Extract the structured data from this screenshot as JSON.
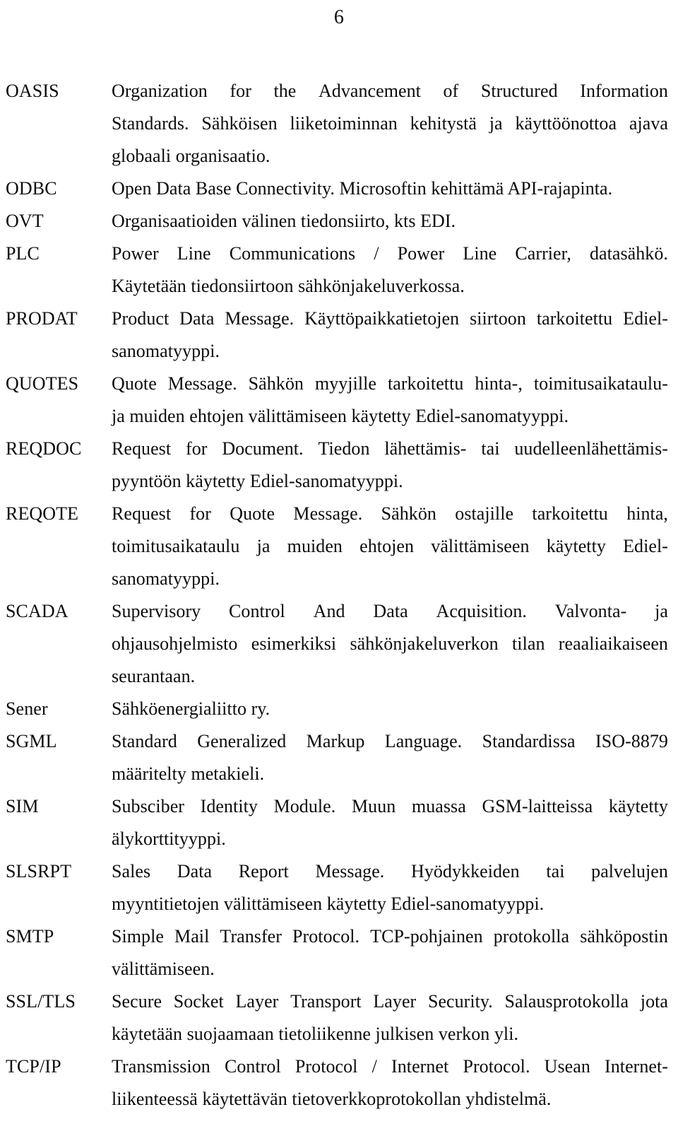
{
  "page": {
    "number": "6"
  },
  "glossary": {
    "entries": [
      {
        "term": "OASIS",
        "lines": [
          "Organization for the Advancement of Structured Information",
          "Standards. Sähköisen liiketoiminnan kehitystä ja käyttöönottoa ajava",
          "globaali organisaatio."
        ]
      },
      {
        "term": "ODBC",
        "lines": [
          "Open Data Base Connectivity. Microsoftin kehittämä API-rajapinta."
        ]
      },
      {
        "term": "OVT",
        "lines": [
          "Organisaatioiden välinen tiedonsiirto, kts EDI."
        ]
      },
      {
        "term": "PLC",
        "lines": [
          "Power Line Communications / Power Line Carrier, datasähkö.",
          "Käytetään tiedonsiirtoon sähkönjakeluverkossa."
        ]
      },
      {
        "term": "PRODAT",
        "lines": [
          "Product Data Message. Käyttöpaikkatietojen siirtoon tarkoitettu Ediel-",
          "sanomatyyppi."
        ]
      },
      {
        "term": "QUOTES",
        "lines": [
          "Quote Message. Sähkön myyjille tarkoitettu hinta-, toimitusaikataulu-",
          "ja muiden ehtojen välittämiseen käytetty Ediel-sanomatyyppi."
        ]
      },
      {
        "term": "REQDOC",
        "lines": [
          "Request for Document. Tiedon lähettämis- tai uudelleenlähettämis-",
          "pyyntöön käytetty Ediel-sanomatyyppi."
        ]
      },
      {
        "term": "REQOTE",
        "lines": [
          "Request for Quote Message. Sähkön ostajille tarkoitettu hinta,",
          "toimitusaikataulu ja muiden ehtojen välittämiseen käytetty Ediel-",
          "sanomatyyppi."
        ]
      },
      {
        "term": "SCADA",
        "lines": [
          "Supervisory Control And Data Acquisition. Valvonta- ja",
          "ohjausohjelmisto esimerkiksi sähkönjakeluverkon tilan reaaliaikaiseen",
          "seurantaan."
        ]
      },
      {
        "term": "Sener",
        "lines": [
          "Sähköenergialiitto ry."
        ]
      },
      {
        "term": "SGML",
        "lines": [
          "Standard Generalized Markup Language. Standardissa ISO-8879",
          "määritelty metakieli."
        ]
      },
      {
        "term": "SIM",
        "lines": [
          "Subsciber Identity Module. Muun muassa GSM-laitteissa käytetty",
          "älykorttityyppi."
        ]
      },
      {
        "term": "SLSRPT",
        "lines": [
          "Sales Data Report Message. Hyödykkeiden tai palvelujen",
          "myyntitietojen välittämiseen käytetty Ediel-sanomatyyppi."
        ]
      },
      {
        "term": "SMTP",
        "lines": [
          "Simple Mail Transfer Protocol. TCP-pohjainen protokolla sähköpostin",
          "välittämiseen."
        ]
      },
      {
        "term": "SSL/TLS",
        "lines": [
          "Secure Socket Layer Transport Layer Security. Salausprotokolla jota",
          "käytetään suojaamaan tietoliikenne julkisen verkon yli."
        ]
      },
      {
        "term": "TCP/IP",
        "lines": [
          "Transmission Control Protocol / Internet Protocol. Usean Internet-",
          "liikenteessä käytettävän tietoverkkoprotokollan yhdistelmä."
        ]
      }
    ]
  }
}
